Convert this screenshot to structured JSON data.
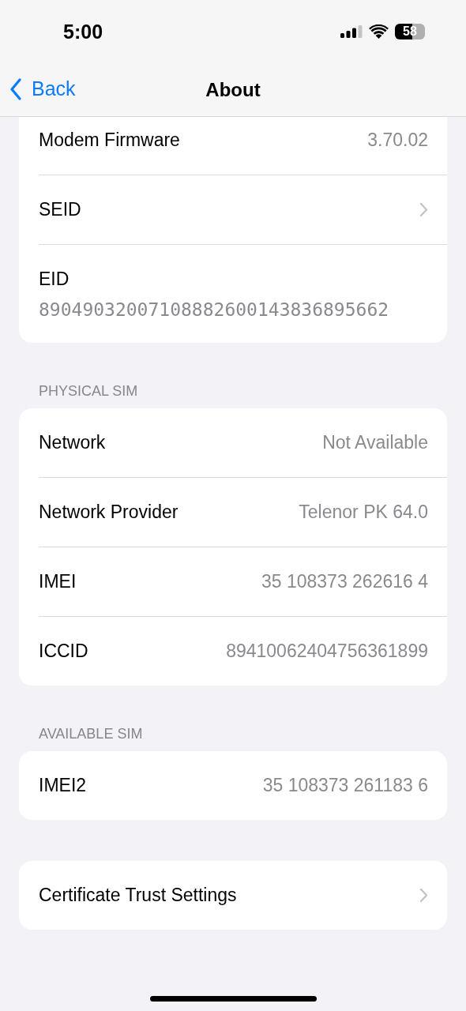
{
  "status_bar": {
    "time": "5:00",
    "battery": "58"
  },
  "nav": {
    "back": "Back",
    "title": "About"
  },
  "sections": [
    {
      "rows": [
        {
          "kind": "value",
          "label": "Modem Firmware",
          "value": "3.70.02"
        },
        {
          "kind": "link",
          "label": "SEID"
        },
        {
          "kind": "stacked",
          "label": "EID",
          "value": "89049032007108882600143836895662"
        }
      ]
    },
    {
      "header": "PHYSICAL SIM",
      "rows": [
        {
          "kind": "value",
          "label": "Network",
          "value": "Not Available"
        },
        {
          "kind": "value",
          "label": "Network Provider",
          "value": "Telenor PK 64.0"
        },
        {
          "kind": "value",
          "label": "IMEI",
          "value": "35 108373 262616 4"
        },
        {
          "kind": "value",
          "label": "ICCID",
          "value": "89410062404756361899"
        }
      ]
    },
    {
      "header": "AVAILABLE SIM",
      "rows": [
        {
          "kind": "value",
          "label": "IMEI2",
          "value": "35 108373 261183 6"
        }
      ]
    },
    {
      "rows": [
        {
          "kind": "link",
          "label": "Certificate Trust Settings"
        }
      ]
    }
  ]
}
